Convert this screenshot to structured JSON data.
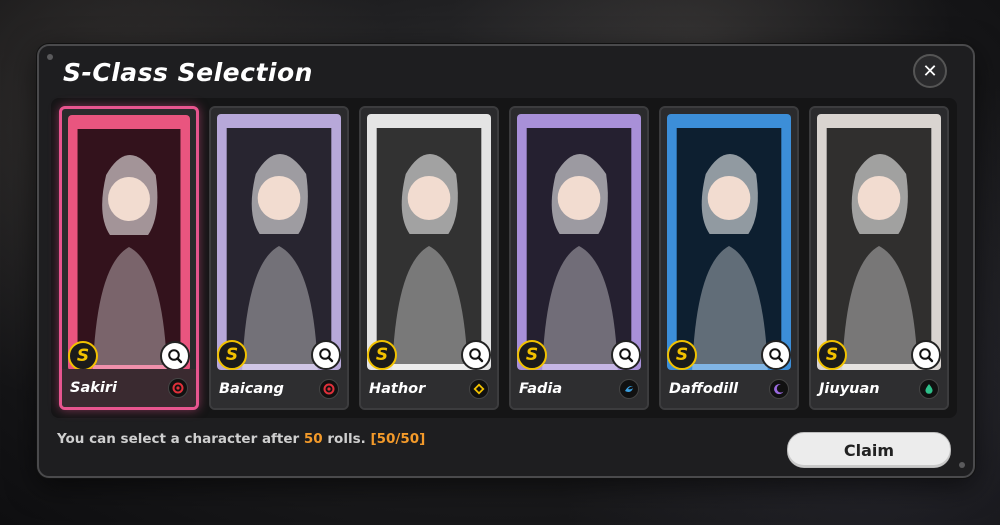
{
  "dialog": {
    "title": "S-Class Selection",
    "close_label": "✕"
  },
  "characters": [
    {
      "name": "Sakiri",
      "rank": "S",
      "element": "crimson-target",
      "element_color": "#e0303a",
      "selected": true,
      "card_bg": "#e9557f"
    },
    {
      "name": "Baicang",
      "rank": "S",
      "element": "crimson-target",
      "element_color": "#e0303a",
      "selected": false,
      "card_bg": "#b7a8d9"
    },
    {
      "name": "Hathor",
      "rank": "S",
      "element": "gold-diamond",
      "element_color": "#f2c200",
      "selected": false,
      "card_bg": "#e4e4e4"
    },
    {
      "name": "Fadia",
      "rank": "S",
      "element": "blue-swirl",
      "element_color": "#3aa0e0",
      "selected": false,
      "card_bg": "#a890d8"
    },
    {
      "name": "Daffodill",
      "rank": "S",
      "element": "violet-crescent",
      "element_color": "#9a6adf",
      "selected": false,
      "card_bg": "#3c8ed8"
    },
    {
      "name": "Jiuyuan",
      "rank": "S",
      "element": "green-drop",
      "element_color": "#2ec08a",
      "selected": false,
      "card_bg": "#d9d4d0"
    }
  ],
  "footer": {
    "prefix": "You can select a character after ",
    "rolls": "50",
    "suffix": " rolls. ",
    "progress": "[50/50]",
    "highlight_color": "#f39a2a"
  },
  "claim_label": "Claim"
}
